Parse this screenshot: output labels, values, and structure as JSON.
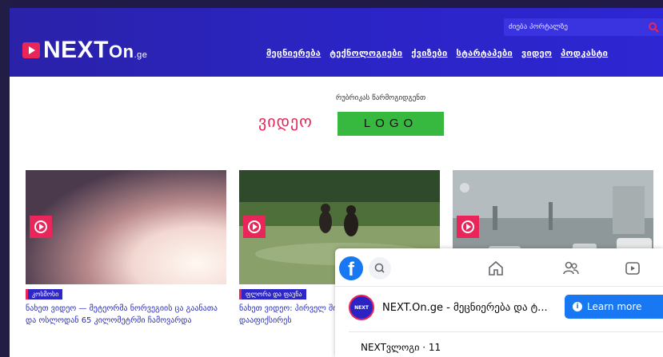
{
  "header": {
    "logo_main": "NEXT",
    "logo_on": "On",
    "logo_ge": ".ge",
    "search_placeholder": "ძიება პორტალზე",
    "nav": [
      {
        "label": "მეცნიერება"
      },
      {
        "label": "ტექნოლოგიები"
      },
      {
        "label": "ქვიზები"
      },
      {
        "label": "სტარტაპები"
      },
      {
        "label": "ვიდეო"
      },
      {
        "label": "პოდკასტი"
      }
    ]
  },
  "page": {
    "category_title": "ვიდეო",
    "sponsor_label": "რუბრიკას წარმოგიდგენთ",
    "sponsor_logo": "LOGO"
  },
  "cards": [
    {
      "tag": "კოსმოსი",
      "title": "ნახეთ ვიდეო — მეტეორმა ნორვეგიის ცა გაანათა და ოსლოდან 65 კილომეტრში ჩამოვარდა"
    },
    {
      "tag": "ფლორა და ფაუნა",
      "title": "ნახეთ ვიდეო: პირველ შიმპანზეების მიერ გო დააფიქსირეს"
    },
    {
      "tag": "",
      "title": ""
    }
  ],
  "facebook": {
    "page_name": "NEXT.On.ge - მეცნიერება და ტ...",
    "avatar_text": "NEXT",
    "learn_more": "Learn more",
    "post_title": "NEXTვლოგი · 11"
  },
  "colors": {
    "brand_blue": "#2b24c4",
    "accent_pink": "#e8265a",
    "sponsor_green": "#37b83e",
    "facebook_blue": "#1877f2"
  }
}
